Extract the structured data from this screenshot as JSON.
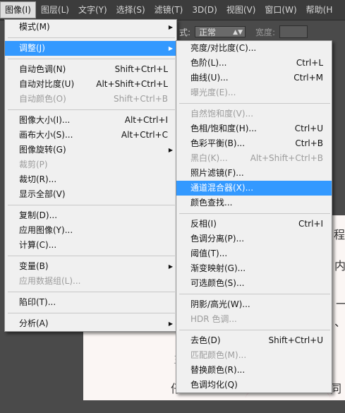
{
  "menubar": {
    "items": [
      {
        "label": "图像(I)",
        "active": true
      },
      {
        "label": "图层(L)"
      },
      {
        "label": "文字(Y)"
      },
      {
        "label": "选择(S)"
      },
      {
        "label": "滤镜(T)"
      },
      {
        "label": "3D(D)"
      },
      {
        "label": "视图(V)"
      },
      {
        "label": "窗口(W)"
      },
      {
        "label": "帮助(H"
      }
    ]
  },
  "options_bar": {
    "mode_label": "式:",
    "mode_value": "正常",
    "width_label": "宽度:"
  },
  "canvas": {
    "fragments": [
      "程",
      "内",
      "一",
      "、",
      "主",
      "仔",
      "同"
    ]
  },
  "image_menu": {
    "items": [
      {
        "label": "模式(M)",
        "submenu": true
      },
      {
        "sep": true
      },
      {
        "label": "调整(J)",
        "submenu": true,
        "highlighted": true
      },
      {
        "sep": true
      },
      {
        "label": "自动色调(N)",
        "shortcut": "Shift+Ctrl+L"
      },
      {
        "label": "自动对比度(U)",
        "shortcut": "Alt+Shift+Ctrl+L"
      },
      {
        "label": "自动颜色(O)",
        "shortcut": "Shift+Ctrl+B",
        "disabled": true
      },
      {
        "sep": true
      },
      {
        "label": "图像大小(I)...",
        "shortcut": "Alt+Ctrl+I"
      },
      {
        "label": "画布大小(S)...",
        "shortcut": "Alt+Ctrl+C"
      },
      {
        "label": "图像旋转(G)",
        "submenu": true
      },
      {
        "label": "裁剪(P)",
        "disabled": true
      },
      {
        "label": "裁切(R)..."
      },
      {
        "label": "显示全部(V)"
      },
      {
        "sep": true
      },
      {
        "label": "复制(D)..."
      },
      {
        "label": "应用图像(Y)..."
      },
      {
        "label": "计算(C)..."
      },
      {
        "sep": true
      },
      {
        "label": "变量(B)",
        "submenu": true
      },
      {
        "label": "应用数据组(L)...",
        "disabled": true
      },
      {
        "sep": true
      },
      {
        "label": "陷印(T)..."
      },
      {
        "sep": true
      },
      {
        "label": "分析(A)",
        "submenu": true
      }
    ]
  },
  "adjust_menu": {
    "items": [
      {
        "label": "亮度/对比度(C)..."
      },
      {
        "label": "色阶(L)...",
        "shortcut": "Ctrl+L"
      },
      {
        "label": "曲线(U)...",
        "shortcut": "Ctrl+M"
      },
      {
        "label": "曝光度(E)...",
        "disabled": true
      },
      {
        "sep": true
      },
      {
        "label": "自然饱和度(V)...",
        "disabled": true
      },
      {
        "label": "色相/饱和度(H)...",
        "shortcut": "Ctrl+U"
      },
      {
        "label": "色彩平衡(B)...",
        "shortcut": "Ctrl+B"
      },
      {
        "label": "黑白(K)...",
        "shortcut": "Alt+Shift+Ctrl+B",
        "disabled": true
      },
      {
        "label": "照片滤镜(F)..."
      },
      {
        "label": "通道混合器(X)...",
        "highlighted": true
      },
      {
        "label": "颜色查找..."
      },
      {
        "sep": true
      },
      {
        "label": "反相(I)",
        "shortcut": "Ctrl+I"
      },
      {
        "label": "色调分离(P)..."
      },
      {
        "label": "阈值(T)..."
      },
      {
        "label": "渐变映射(G)..."
      },
      {
        "label": "可选颜色(S)..."
      },
      {
        "sep": true
      },
      {
        "label": "阴影/高光(W)..."
      },
      {
        "label": "HDR 色调...",
        "disabled": true
      },
      {
        "sep": true
      },
      {
        "label": "去色(D)",
        "shortcut": "Shift+Ctrl+U"
      },
      {
        "label": "匹配颜色(M)...",
        "disabled": true
      },
      {
        "label": "替换颜色(R)..."
      },
      {
        "label": "色调均化(Q)"
      }
    ]
  }
}
